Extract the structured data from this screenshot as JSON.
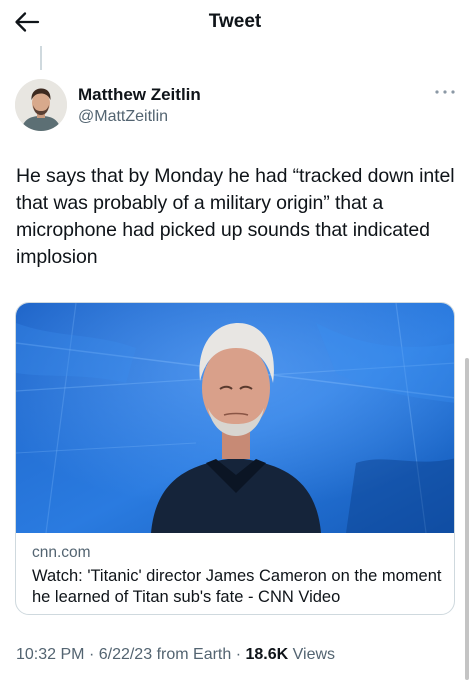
{
  "header": {
    "title": "Tweet",
    "back_icon": "arrow-left-icon"
  },
  "author": {
    "name": "Matthew Zeitlin",
    "handle": "@MattZeitlin",
    "avatar_icon": "avatar-photo",
    "more_icon": "more-horizontal-icon"
  },
  "tweet": {
    "text": "He says that by Monday he had “tracked down intel that was probably of a military origin” that a microphone had picked up sounds that indicated implosion"
  },
  "card": {
    "image_icon": "video-thumbnail",
    "domain": "cnn.com",
    "title": "Watch: 'Titanic' director James Cameron on the moment he learned of Titan sub's fate - CNN Video"
  },
  "meta": {
    "time": "10:32 PM",
    "separator": "·",
    "date": "6/22/23",
    "source_prefix": "from",
    "source": "Earth",
    "views_count": "18.6K",
    "views_label": "Views"
  },
  "colors": {
    "text_primary": "#0f1419",
    "text_secondary": "#536471",
    "border": "#cfd9de"
  }
}
